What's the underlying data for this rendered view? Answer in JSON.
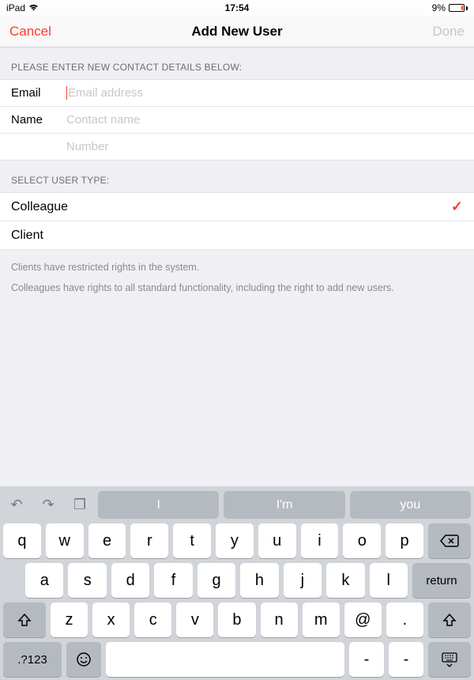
{
  "status": {
    "device": "iPad",
    "wifi": "᯾",
    "time": "17:54",
    "battery_pct": "9%"
  },
  "nav": {
    "cancel": "Cancel",
    "title": "Add New User",
    "done": "Done"
  },
  "section1": {
    "header": "Please enter new contact details below:",
    "rows": {
      "email": {
        "label": "Email",
        "placeholder": "Email address"
      },
      "name": {
        "label": "Name",
        "placeholder": "Contact name"
      },
      "number": {
        "label": "",
        "placeholder": "Number"
      }
    }
  },
  "section2": {
    "header": "Select user type:",
    "options": [
      {
        "label": "Colleague",
        "selected": true
      },
      {
        "label": "Client",
        "selected": false
      }
    ],
    "footer1": "Clients have restricted rights in the system.",
    "footer2": "Colleagues have rights to all standard functionality, including the right to add new users."
  },
  "keyboard": {
    "suggestions": [
      "I",
      "I'm",
      "you"
    ],
    "row1": [
      "q",
      "w",
      "e",
      "r",
      "t",
      "y",
      "u",
      "i",
      "o",
      "p"
    ],
    "row2": [
      "a",
      "s",
      "d",
      "f",
      "g",
      "h",
      "j",
      "k",
      "l"
    ],
    "row3": [
      "z",
      "x",
      "c",
      "v",
      "b",
      "n",
      "m",
      "@",
      "."
    ],
    "row4": {
      "numkey": ".?123",
      "dash": "-",
      "underscore": "-"
    },
    "return": "return"
  }
}
